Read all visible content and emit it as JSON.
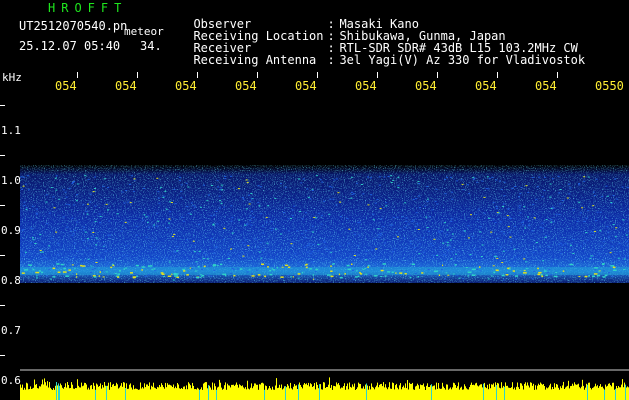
{
  "header": {
    "app_title": "HROFFT",
    "file_name": "UT2512070540.pn",
    "mode": "meteor",
    "datetime": "25.12.07 05:40",
    "count": "34.",
    "info": [
      {
        "label": "Observer",
        "value": "Masaki Kano"
      },
      {
        "label": "Receiving Location",
        "value": "Shibukawa, Gunma, Japan"
      },
      {
        "label": "Receiver",
        "value": "RTL-SDR SDR# 43dB L15 103.2MHz CW"
      },
      {
        "label": "Receiving Antenna",
        "value": "3el Yagi(V) Az 330 for Vladivostok"
      }
    ],
    "separator": ":"
  },
  "axes": {
    "unit": "kHz",
    "time_ticks": [
      "054",
      "054",
      "054",
      "054",
      "054",
      "054",
      "054",
      "054",
      "054",
      "0550"
    ],
    "freq_ticks": [
      "1.1",
      "1.0",
      "0.9",
      "0.8",
      "0.7",
      "0.6"
    ]
  },
  "colors": {
    "title": "#1ee61e",
    "tick_time": "#ffee33",
    "noise_band_dark": "#0a1d8c",
    "noise_band_mid": "#1f5fe0",
    "noise_band_hot": "#2fd3c8",
    "signal_peak": "#e0e020",
    "signal_bottom": "#ffff00"
  }
}
